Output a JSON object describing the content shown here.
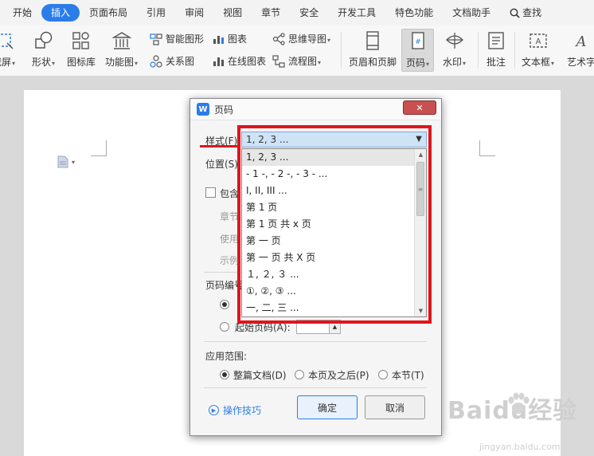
{
  "menu": {
    "items": [
      "开始",
      "插入",
      "页面布局",
      "引用",
      "审阅",
      "视图",
      "章节",
      "安全",
      "开发工具",
      "特色功能",
      "文档助手"
    ],
    "active": "插入",
    "search_label": "查找"
  },
  "ribbon": {
    "screenshot": "截屏",
    "shape": "形状",
    "icon_lib": "图标库",
    "func_chart": "功能图",
    "smart_shape": "智能图形",
    "relation_chart": "关系图",
    "chart": "图表",
    "online_chart": "在线图表",
    "mind_map": "思维导图",
    "flow_chart": "流程图",
    "header_footer": "页眉和页脚",
    "page_number": "页码",
    "watermark": "水印",
    "comment": "批注",
    "textbox": "文本框",
    "art_text": "艺术字"
  },
  "dialog": {
    "title": "页码",
    "style_label": "样式(F):",
    "style_value": "1, 2, 3 ...",
    "position_label": "位置(S):",
    "include_label": "包含",
    "chapter_label": "章节",
    "use_label": "使用",
    "example_label": "示例",
    "numbering_label": "页码编号",
    "start_page_label": "起始页码(A):",
    "scope_label": "应用范围:",
    "scope_options": [
      "整篇文档(D)",
      "本页及之后(P)",
      "本节(T)"
    ],
    "tips_label": "操作技巧",
    "ok_label": "确定",
    "cancel_label": "取消"
  },
  "dropdown": {
    "items": [
      "1, 2, 3 ...",
      "- 1 -, - 2 -, - 3 - ...",
      "I, II, III ...",
      "第 1 页",
      "第 1 页 共 x 页",
      "第 一 页",
      "第 一 页 共 X 页",
      "１, ２, ３ ...",
      "①, ②, ③ ...",
      "一, 二, 三 ..."
    ]
  },
  "watermark": {
    "text": "Baidu经验",
    "url": "jingyan.baidu.com"
  },
  "colors": {
    "accent": "#2b7de9",
    "annotation": "#e0151b"
  }
}
